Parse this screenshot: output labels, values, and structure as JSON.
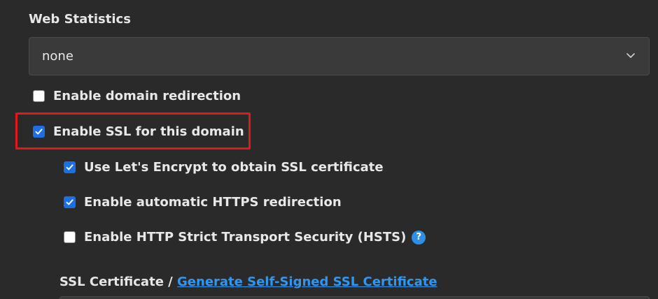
{
  "web_statistics": {
    "label": "Web Statistics",
    "selected_value": "none",
    "chevron_icon": "chevron-down-icon"
  },
  "options": {
    "domain_redirection": {
      "label": "Enable domain redirection",
      "checked": false
    },
    "enable_ssl": {
      "label": "Enable SSL for this domain",
      "checked": true
    },
    "lets_encrypt": {
      "label": "Use Let's Encrypt to obtain SSL certificate",
      "checked": true
    },
    "https_redirection": {
      "label": "Enable automatic HTTPS redirection",
      "checked": true
    },
    "hsts": {
      "label": "Enable HTTP Strict Transport Security (HSTS)",
      "checked": false,
      "help_icon": "?"
    }
  },
  "ssl_certificate": {
    "label": "SSL Certificate",
    "separator": " / ",
    "link_text": "Generate Self-Signed SSL Certificate"
  },
  "colors": {
    "background": "#2a2a2a",
    "accent": "#1d6fe6",
    "link": "#2f97f2",
    "highlight": "#e3181d"
  }
}
